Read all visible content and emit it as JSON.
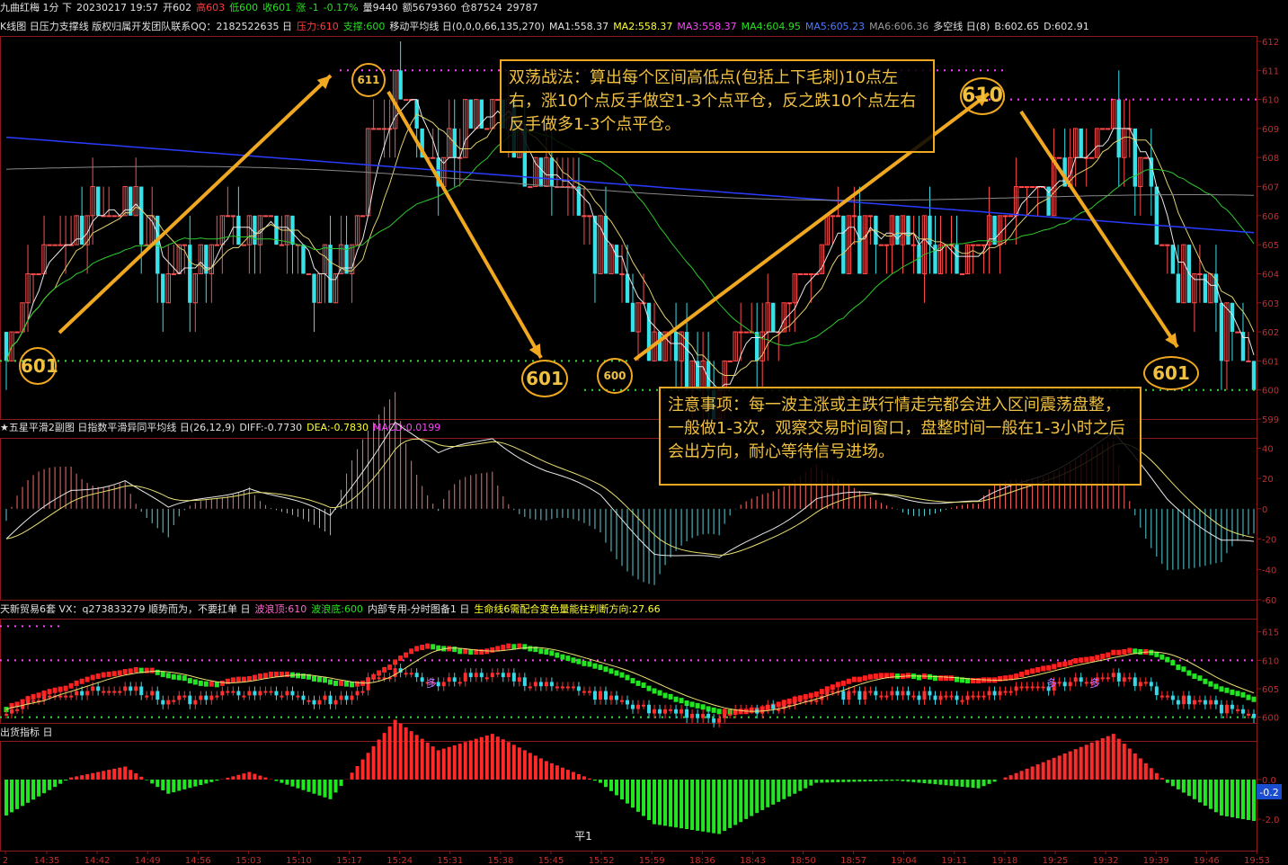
{
  "header": {
    "title": "九曲红梅 1分 下",
    "fields": [
      {
        "t": "20230217 19:57",
        "c": "w"
      },
      {
        "t": "开602",
        "c": "w"
      },
      {
        "t": "高603",
        "c": "r"
      },
      {
        "t": "低600",
        "c": "g"
      },
      {
        "t": "收601",
        "c": "g"
      },
      {
        "t": "涨 -1",
        "c": "g"
      },
      {
        "t": "-0.17%",
        "c": "g"
      },
      {
        "t": "量9440",
        "c": "w"
      },
      {
        "t": "额5679360",
        "c": "w"
      },
      {
        "t": "仓87524",
        "c": "w"
      },
      {
        "t": "29787",
        "c": "w"
      }
    ]
  },
  "k_line_bar": [
    {
      "t": "K线图 日压力支撑线 版权归属开发团队联系QQ：2182522635 日",
      "c": "w"
    },
    {
      "t": "压力:610",
      "c": "r"
    },
    {
      "t": "支撑:600",
      "c": "g"
    },
    {
      "t": "移动平均线 日(0,0,0,66,135,270)",
      "c": "w"
    },
    {
      "t": "MA1:558.37",
      "c": "w"
    },
    {
      "t": "MA2:558.37",
      "c": "y"
    },
    {
      "t": "MA3:558.37",
      "c": "m"
    },
    {
      "t": "MA4:604.95",
      "c": "g"
    },
    {
      "t": "MA5:605.23",
      "c": "b"
    },
    {
      "t": "MA6:606.36",
      "c": "gray"
    },
    {
      "t": "多空线 日(8)",
      "c": "w"
    },
    {
      "t": "B:602.65",
      "c": "w"
    },
    {
      "t": "D:602.91",
      "c": "w"
    }
  ],
  "macd_bar": [
    {
      "t": "★五星平滑2副图 日指数平滑异同平均线 日(26,12,9)",
      "c": "w"
    },
    {
      "t": "DIFF:-0.7730",
      "c": "w"
    },
    {
      "t": "DEA:-0.7830",
      "c": "y"
    },
    {
      "t": "MACD:0.0199",
      "c": "m"
    }
  ],
  "trade_bar": [
    {
      "t": "天新贸易6套 VX：q273833279  顺势而为，不要扛单 日",
      "c": "w"
    },
    {
      "t": "波浪顶:610",
      "c": "pink"
    },
    {
      "t": "波浪底:600",
      "c": "g"
    },
    {
      "t": "内部专用-分时图备1 日",
      "c": "w"
    },
    {
      "t": "生命线6需配合变色量能柱判断方向:27.66",
      "c": "y"
    }
  ],
  "out_bar": [
    {
      "t": "出货指标 日",
      "c": "w"
    }
  ],
  "annotations": {
    "strategy": "双荡战法：算出每个区间高低点(包括上下毛刺)10点左右，涨10个点反手做空1-3个点平仓，反之跌10个点左右反手做多1-3个点平仓。",
    "notice": "注意事项：每一波主涨或主跌行情走完都会进入区间震荡盘整，一般做1-3次，观察交易时间窗口，盘整时间一般在1-3小时之后会出方向，耐心等待信号进场。"
  },
  "markers": {
    "m1": "601",
    "m2": "611",
    "m3": "601",
    "m4": "600",
    "m5": "610",
    "m6": "601",
    "flat_label": "平1",
    "out_value": "-0.2"
  },
  "chart_data": [
    {
      "type": "candlestick",
      "name": "price",
      "ylim": [
        599,
        612
      ],
      "y_ticks": [
        "612",
        "611",
        "610",
        "609",
        "608",
        "607",
        "606",
        "605",
        "604",
        "603",
        "602",
        "601",
        "600",
        "599"
      ],
      "resistance": 611,
      "resistance2": 610,
      "support": 601,
      "support2": 600,
      "moving_averages": [
        "MA4 604.95",
        "MA5 605.23",
        "MA6 606.36"
      ],
      "key_points": [
        {
          "label": "601",
          "type": "low"
        },
        {
          "label": "611",
          "type": "high"
        },
        {
          "label": "601",
          "type": "low"
        },
        {
          "label": "600",
          "type": "low"
        },
        {
          "label": "610",
          "type": "high"
        },
        {
          "label": "601",
          "type": "low"
        }
      ]
    },
    {
      "type": "bar",
      "name": "MACD",
      "ylim": [
        -60,
        45
      ],
      "y_ticks": [
        "40",
        "20",
        "0",
        "-20",
        "-40",
        "-60"
      ],
      "DIFF": -0.773,
      "DEA": -0.783,
      "MACD": 0.0199
    },
    {
      "type": "candlestick",
      "name": "trade",
      "ylim": [
        599,
        617
      ],
      "y_ticks": [
        "615",
        "610",
        "605",
        "600"
      ],
      "wave_top": 610,
      "wave_bottom": 600,
      "life_line": 27.66,
      "labels": [
        "多",
        "多",
        "多"
      ]
    },
    {
      "type": "bar",
      "name": "out",
      "y_ticks": [
        "0.0",
        "-2.0"
      ],
      "last": -0.2
    }
  ],
  "x_axis": [
    "2",
    "14:35",
    "14:42",
    "14:49",
    "14:56",
    "15:03",
    "15:10",
    "15:17",
    "15:24",
    "15:31",
    "15:38",
    "15:45",
    "15:52",
    "15:59",
    "18:36",
    "18:43",
    "18:50",
    "18:57",
    "19:04",
    "19:11",
    "19:18",
    "19:25",
    "19:32",
    "19:39",
    "19:46",
    "19:53"
  ]
}
